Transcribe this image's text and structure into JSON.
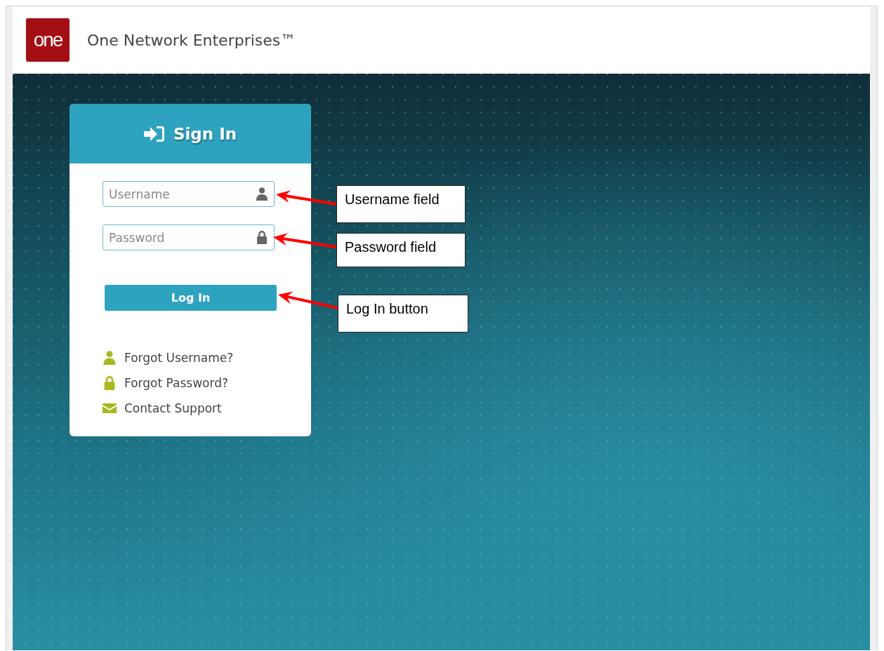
{
  "header": {
    "logo_text": "one",
    "title": "One Network Enterprises™"
  },
  "sign_in": {
    "title": "Sign In",
    "fields": [
      {
        "kind": "user",
        "placeholder": "Username"
      },
      {
        "kind": "password",
        "placeholder": "Password"
      }
    ],
    "button": "Log In",
    "links": [
      {
        "kind": "user",
        "label": "Forgot Username?"
      },
      {
        "kind": "lock",
        "label": "Forgot Password?"
      },
      {
        "kind": "mail",
        "label": "Contact Support"
      }
    ]
  },
  "annotations": [
    {
      "label": "Username field"
    },
    {
      "label": "Password field"
    },
    {
      "label": "Log In button"
    }
  ]
}
